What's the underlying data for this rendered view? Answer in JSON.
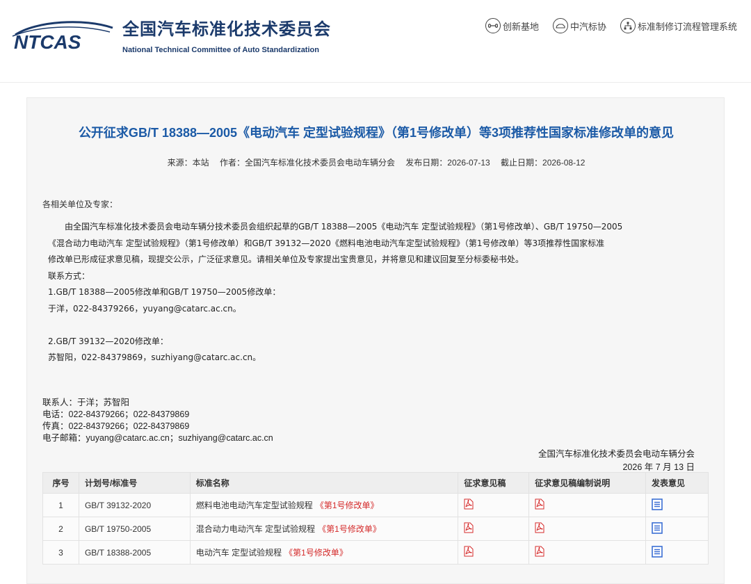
{
  "header": {
    "logo_text": "NTCAS",
    "cn_title": "全国汽车标准化技术委员会",
    "en_title": "National Technical Committee of Auto Standardization",
    "links": [
      {
        "label": "创新基地",
        "icon": "infinity-circle-icon"
      },
      {
        "label": "中汽标协",
        "icon": "car-circle-icon"
      },
      {
        "label": "标准制修订流程管理系统",
        "icon": "hierarchy-circle-icon"
      }
    ]
  },
  "article": {
    "title": "公开征求GB/T 18388—2005《电动汽车 定型试验规程》（第1号修改单）等3项推荐性国家标准修改单的意见",
    "meta": {
      "source": "来源：本站",
      "author": "作者：全国汽车标准化技术委员会电动车辆分会",
      "publish": "发布日期：2026-07-13",
      "deadline": "截止日期：2026-08-12"
    },
    "salutation": "各相关单位及专家：",
    "paragraph_lines": [
      "由全国汽车标准化技术委员会电动车辆分技术委员会组织起草的GB/T 18388—2005《电动汽车 定型试验规程》（第1号修改单）、GB/T 19750—2005",
      "《混合动力电动汽车 定型试验规程》（第1号修改单）和GB/T 39132—2020《燃料电池电动汽车定型试验规程》（第1号修改单）等3项推荐性国家标准",
      "修改单已形成征求意见稿，现提交公示，广泛征求意见。请相关单位及专家提出宝贵意见，并将意见和建议回复至分标委秘书处。"
    ],
    "contact_heading": "联系方式：",
    "contact1_title": "1.GB/T 18388—2005修改单和GB/T 19750—2005修改单：",
    "contact1_detail": "于洋，022-84379266，yuyang@catarc.ac.cn。",
    "contact2_title": "2.GB/T 39132—2020修改单：",
    "contact2_detail": "苏智阳，022-84379869，suzhiyang@catarc.ac.cn。",
    "contact_block": {
      "person": "联系人：于洋；苏智阳",
      "phone": "电话：022-84379266；022-84379869",
      "fax": "传真：022-84379266；022-84379869",
      "email": "电子邮箱：yuyang@catarc.ac.cn；suzhiyang@catarc.ac.cn"
    },
    "signature": {
      "org": "全国汽车标准化技术委员会电动车辆分会",
      "date": "2026 年 7 月 13 日"
    }
  },
  "table": {
    "headers": [
      "序号",
      "计划号/标准号",
      "标准名称",
      "征求意见稿",
      "征求意见稿编制说明",
      "发表意见"
    ],
    "rows": [
      {
        "no": "1",
        "code": "GB/T 39132-2020",
        "name": "燃料电池电动汽车定型试验规程",
        "tag": "《第1号修改单》"
      },
      {
        "no": "2",
        "code": "GB/T 19750-2005",
        "name": "混合动力电动汽车 定型试验规程",
        "tag": "《第1号修改单》"
      },
      {
        "no": "3",
        "code": "GB/T 18388-2005",
        "name": "电动汽车 定型试验规程",
        "tag": "《第1号修改单》"
      }
    ],
    "icons": {
      "draft": "pdf-icon",
      "explanation": "pdf-icon",
      "feedback": "document-list-icon"
    }
  },
  "colors": {
    "title_blue": "#1b5aa6",
    "brand_navy": "#1b3a6b",
    "tag_red": "#d42a2a",
    "panel_bg": "#f6f6f6"
  }
}
